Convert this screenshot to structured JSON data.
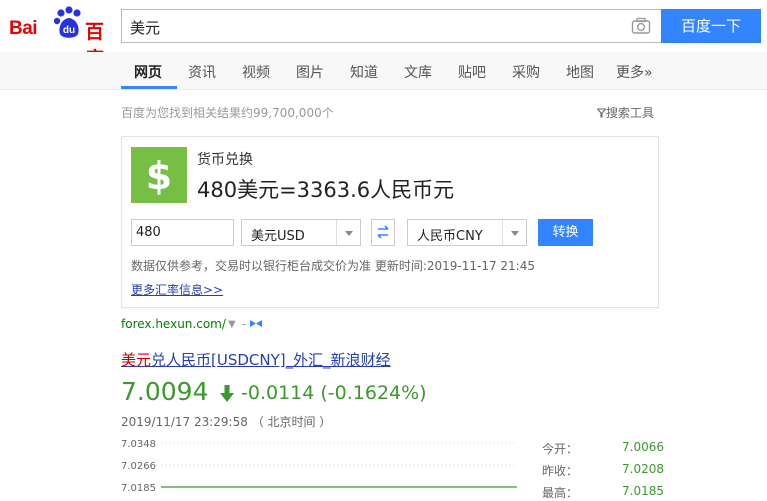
{
  "header": {
    "logo_text_latin": "Bai",
    "logo_text_du": "du",
    "logo_text_cn": "百度",
    "search_query": "美元",
    "camera_icon": "camera-icon",
    "search_button": "百度一下"
  },
  "tabs": [
    {
      "label": "网页",
      "active": true
    },
    {
      "label": "资讯"
    },
    {
      "label": "视频"
    },
    {
      "label": "图片"
    },
    {
      "label": "知道"
    },
    {
      "label": "文库"
    },
    {
      "label": "贴吧"
    },
    {
      "label": "采购"
    },
    {
      "label": "地图"
    },
    {
      "label": "更多»"
    }
  ],
  "meta": {
    "result_count": "百度为您找到相关结果约99,700,000个",
    "search_tools": "搜索工具"
  },
  "converter": {
    "title": "货币兑换",
    "result": "480美元=3363.6人民币元",
    "amount": "480",
    "from_currency": "美元USD",
    "to_currency": "人民币CNY",
    "convert_button": "转换",
    "note": "数据仅供参考，交易时以银行柜台成交价为准 更新时间:2019-11-17 21:45",
    "more_link": "更多汇率信息>>",
    "badge_symbol": "$",
    "badge_color": "#76bf44"
  },
  "source": {
    "url": "forex.hexun.com/",
    "dropdown": "▼",
    "dash": "-"
  },
  "result": {
    "title_highlight": "美元",
    "title_rest": "兑人民币[USDCNY]_外汇_新浪财经",
    "price": "7.0094",
    "change": "-0.0114 (-0.1624%)",
    "timestamp": "2019/11/17 23:29:58   （ 北京时间 ）",
    "down_color": "#3a9a2c"
  },
  "chart_data": {
    "type": "line",
    "y_ticks": [
      "7.0348",
      "7.0266",
      "7.0185"
    ],
    "ylim": [
      7.0185,
      7.0348
    ],
    "series": [
      {
        "x": [
          0,
          1
        ],
        "values": [
          7.0185,
          7.0185
        ]
      }
    ]
  },
  "stats": [
    {
      "label": "今开：",
      "value": "7.0066"
    },
    {
      "label": "昨收：",
      "value": "7.0208"
    },
    {
      "label": "最高：",
      "value": "7.0185"
    }
  ]
}
